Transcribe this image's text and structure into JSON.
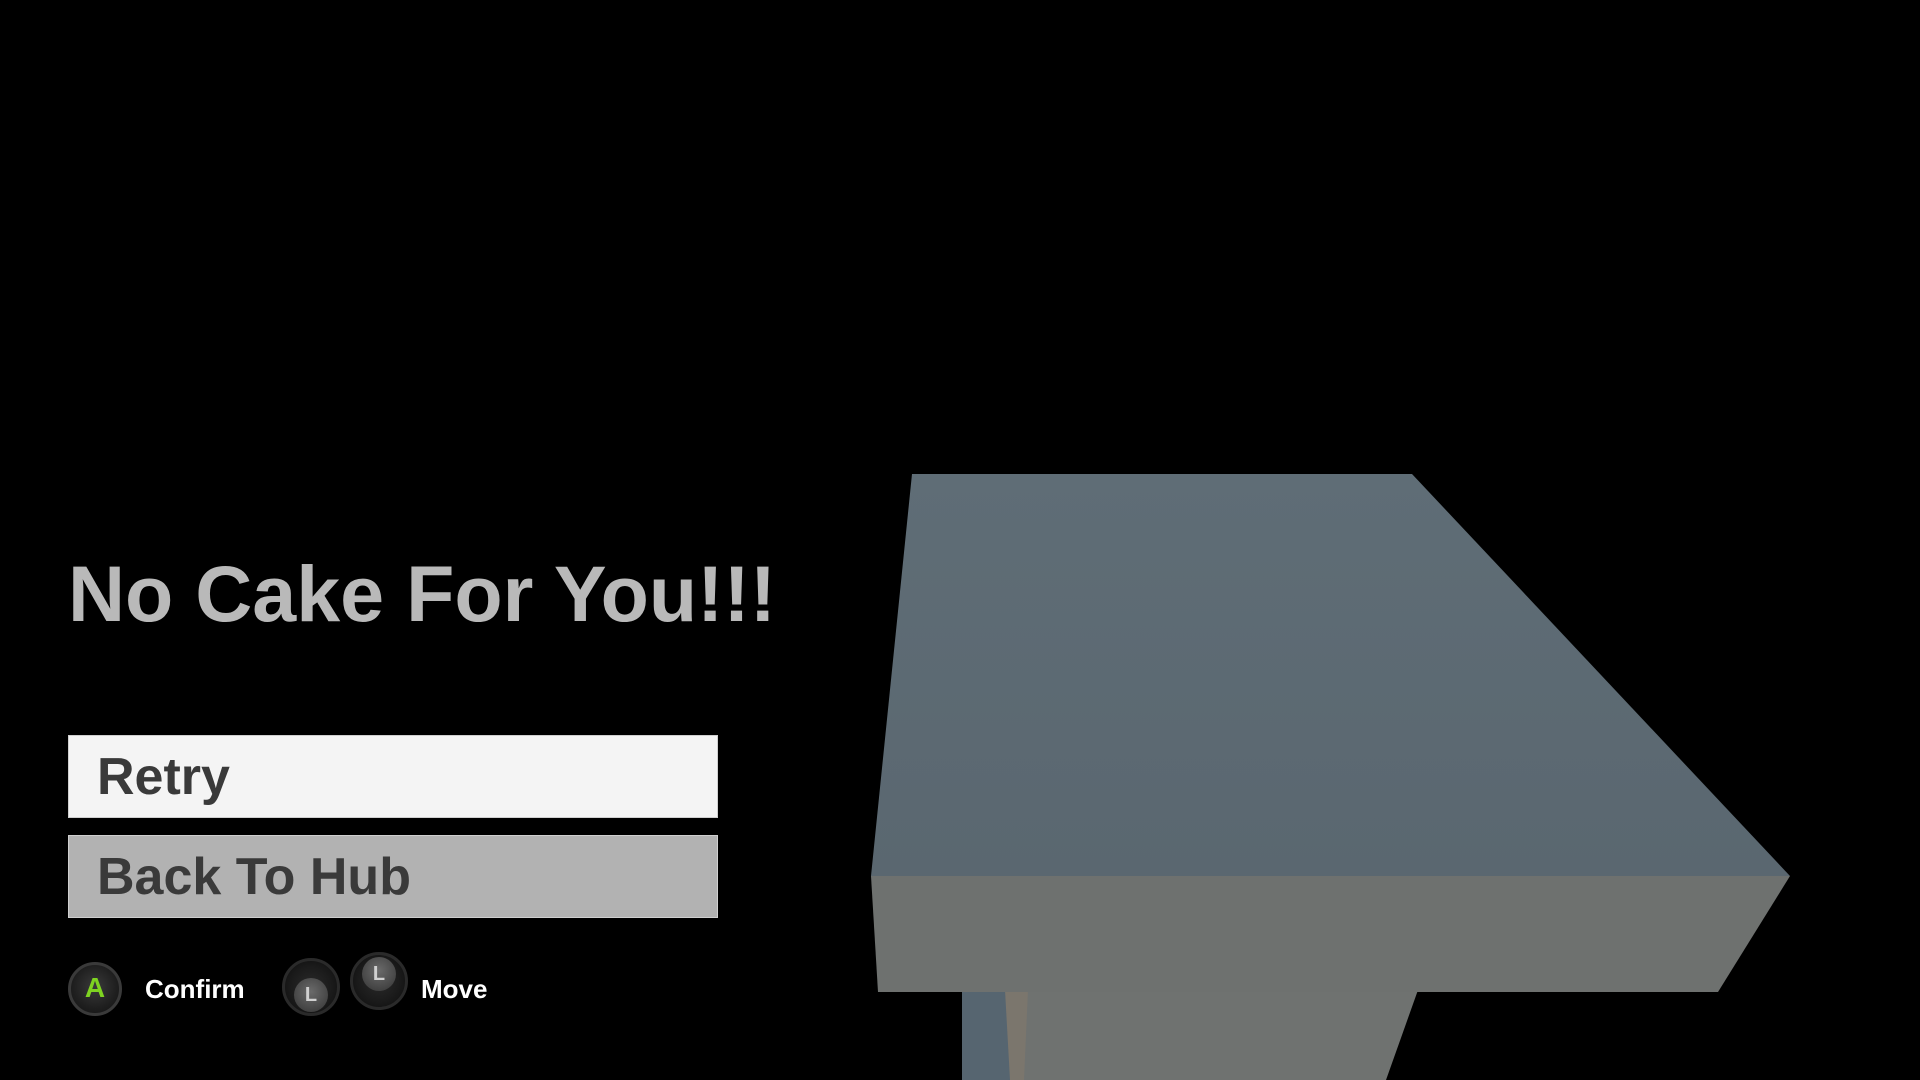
{
  "screen": {
    "title": "No Cake For You!!!",
    "background_color": "#000000",
    "title_color": "#b9b9b9"
  },
  "menu": {
    "items": [
      {
        "label": "Retry",
        "state": "selected",
        "color": "#f4f4f4"
      },
      {
        "label": "Back To Hub",
        "state": "unselected",
        "color": "#b2b2b2"
      }
    ]
  },
  "controls": {
    "confirm": {
      "button": "A",
      "icon": "a-button-icon",
      "label": "Confirm",
      "accent": "#7ed321"
    },
    "move": {
      "button": "L",
      "icon": "left-stick-icon",
      "label": "Move"
    }
  },
  "scene_object": {
    "icon": "gray-block-platform",
    "top_color": "#5d6a73",
    "side_color": "#6e716f"
  }
}
